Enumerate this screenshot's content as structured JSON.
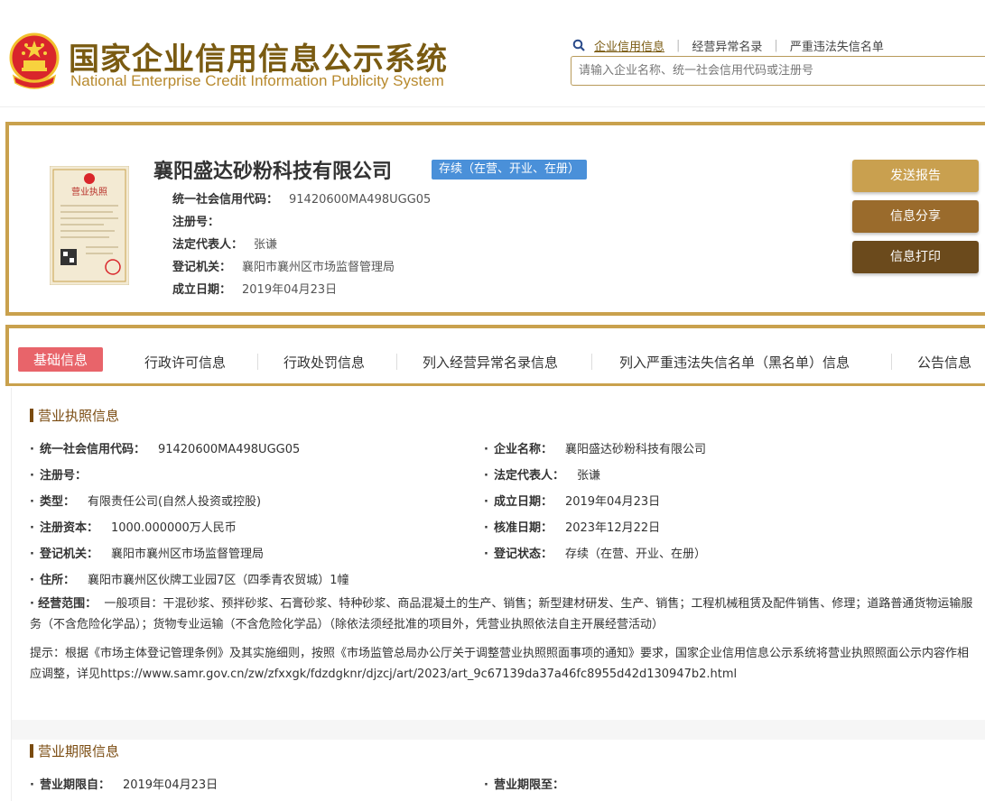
{
  "header": {
    "title_cn": "国家企业信用信息公示系统",
    "title_en": "National Enterprise Credit Information Publicity System",
    "nav_links": [
      "企业信用信息",
      "经营异常名录",
      "严重违法失信名单"
    ],
    "search_placeholder": "请输入企业名称、统一社会信用代码或注册号"
  },
  "company": {
    "name": "襄阳盛达砂粉科技有限公司",
    "status": "存续（在营、开业、在册）",
    "license_thumb_label": "营业执照",
    "rows": [
      {
        "label": "统一社会信用代码：",
        "value": "91420600MA498UGG05"
      },
      {
        "label": "注册号：",
        "value": ""
      },
      {
        "label": "法定代表人：",
        "value": "张谦"
      },
      {
        "label": "登记机关：",
        "value": "襄阳市襄州区市场监督管理局"
      },
      {
        "label": "成立日期：",
        "value": "2019年04月23日"
      }
    ],
    "buttons": {
      "report": "发送报告",
      "share": "信息分享",
      "print": "信息打印"
    }
  },
  "tabs": [
    "基础信息",
    "行政许可信息",
    "行政处罚信息",
    "列入经营异常名录信息",
    "列入严重违法失信名单（黑名单）信息",
    "公告信息"
  ],
  "license_section": {
    "title": "营业执照信息",
    "left_fields": [
      {
        "label": "统一社会信用代码：",
        "value": "91420600MA498UGG05"
      },
      {
        "label": "注册号：",
        "value": ""
      },
      {
        "label": "类型：",
        "value": "有限责任公司(自然人投资或控股)"
      },
      {
        "label": "注册资本：",
        "value": "1000.000000万人民币"
      },
      {
        "label": "登记机关：",
        "value": "襄阳市襄州区市场监督管理局"
      },
      {
        "label": "住所：",
        "value": "襄阳市襄州区伙牌工业园7区（四季青农贸城）1幢"
      }
    ],
    "right_fields": [
      {
        "label": "企业名称：",
        "value": "襄阳盛达砂粉科技有限公司"
      },
      {
        "label": "法定代表人：",
        "value": "张谦"
      },
      {
        "label": "成立日期：",
        "value": "2019年04月23日"
      },
      {
        "label": "核准日期：",
        "value": "2023年12月22日"
      },
      {
        "label": "登记状态：",
        "value": "存续（在营、开业、在册）"
      }
    ],
    "scope_label": "经营范围：",
    "scope_value": "一般项目：干混砂浆、预拌砂浆、石膏砂浆、特种砂浆、商品混凝土的生产、销售；新型建材研发、生产、销售；工程机械租赁及配件销售、修理；道路普通货物运输服务（不含危险化学品）；货物专业运输（不含危险化学品）（除依法须经批准的项目外，凭营业执照依法自主开展经营活动）",
    "notice": "提示：根据《市场主体登记管理条例》及其实施细则，按照《市场监管总局办公厅关于调整营业执照照面事项的通知》要求，国家企业信用信息公示系统将营业执照照面公示内容作相应调整，详见https://www.samr.gov.cn/zw/zfxxgk/fdzdgknr/djzcj/art/2023/art_9c67139da37a46fc8955d42d130947b2.html"
  },
  "term_section": {
    "title": "营业期限信息",
    "from_label": "营业期限自：",
    "from_value": "2019年04月23日",
    "to_label": "营业期限至：",
    "to_value": ""
  },
  "colors": {
    "gold": "#c9a14d",
    "brown": "#7a4b10",
    "active_tab": "#e8646a",
    "status_blue": "#4a90d9"
  }
}
